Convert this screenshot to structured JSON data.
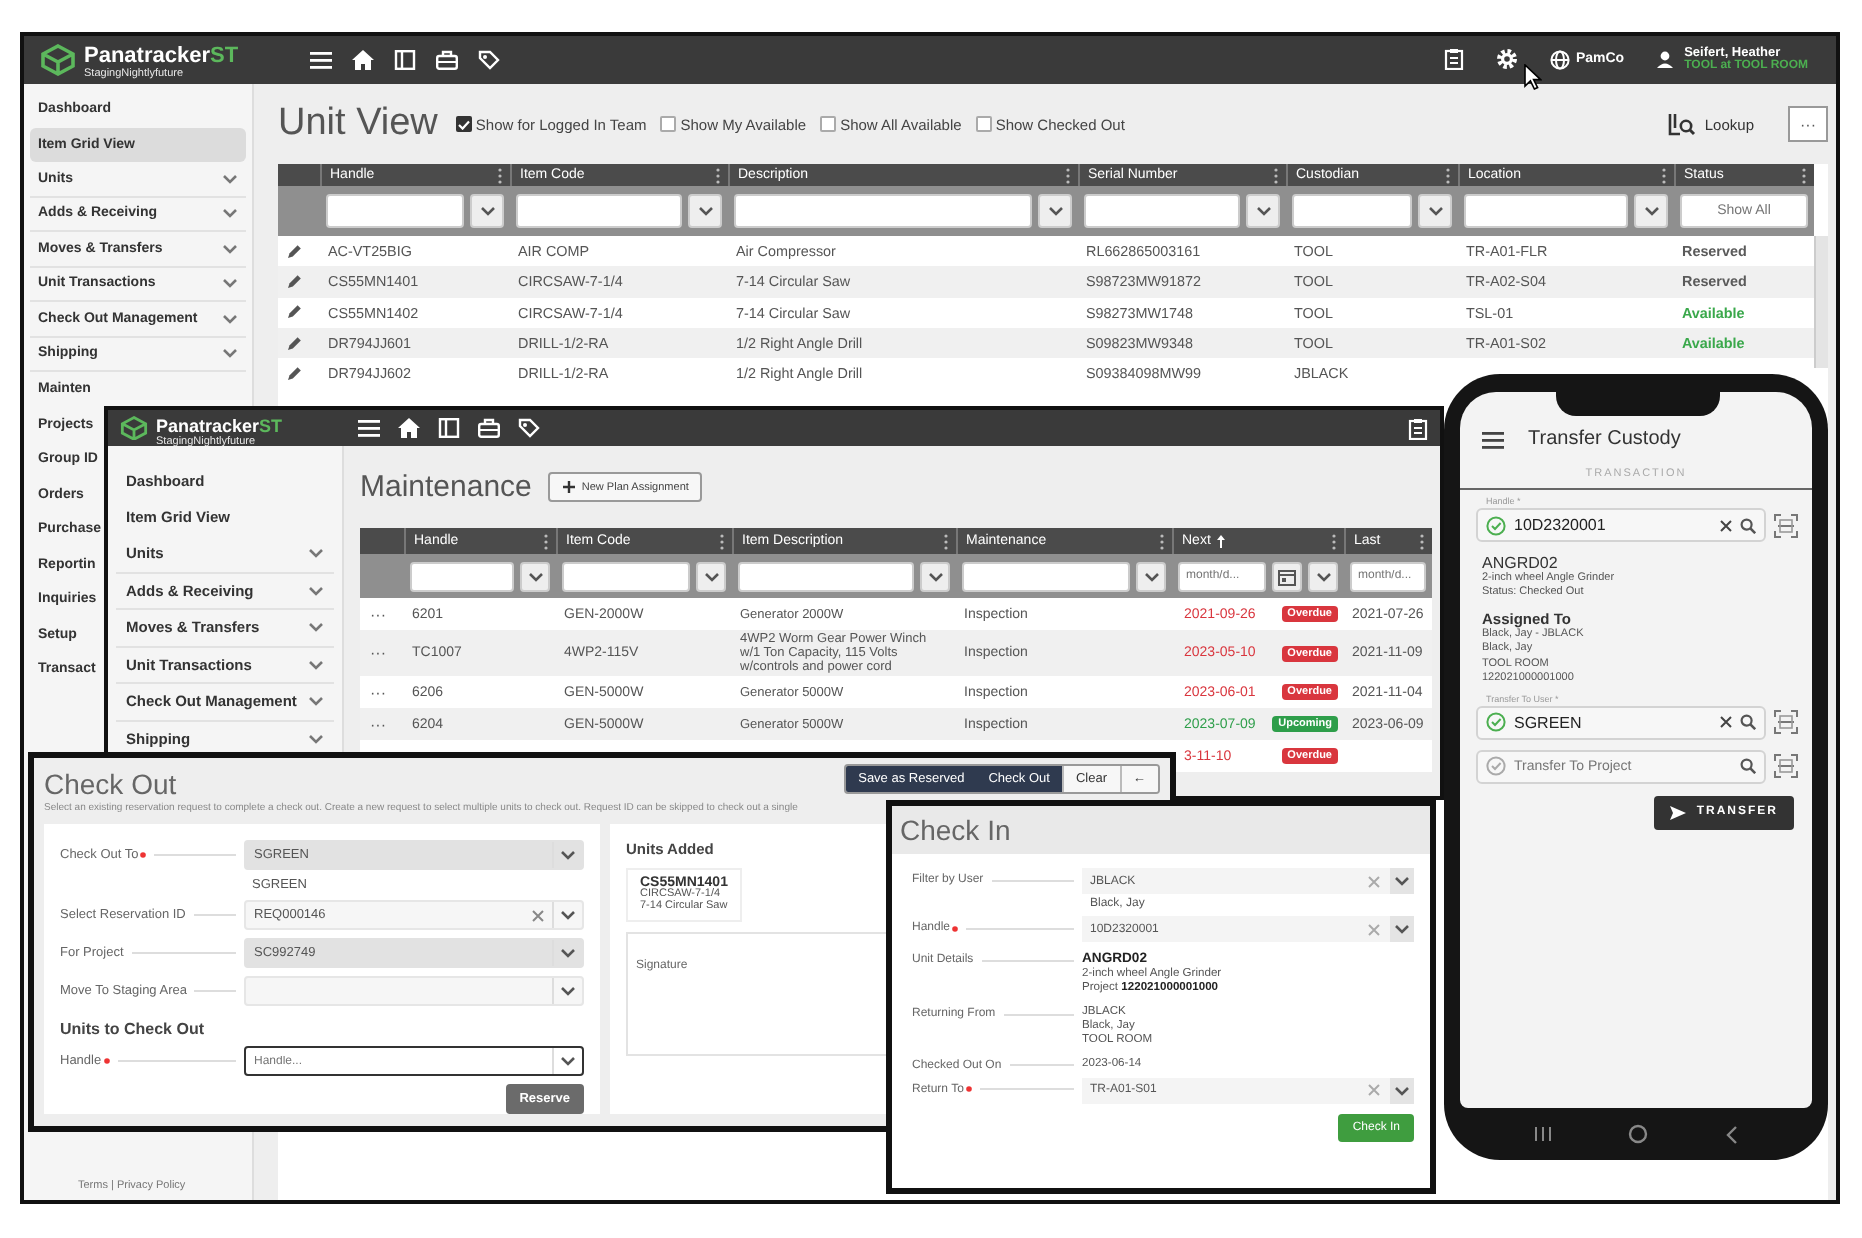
{
  "main": {
    "brand": "Panatracker",
    "brand_suffix": "ST",
    "env": "StagingNightlyfuture",
    "company": "PamCo",
    "user": "Seifert, Heather",
    "user_location": "TOOL at TOOL ROOM",
    "sidebar": [
      {
        "label": "Dashboard",
        "kind": "link",
        "selected": false
      },
      {
        "label": "Item Grid View",
        "kind": "link",
        "selected": true
      },
      {
        "label": "Units",
        "kind": "group",
        "selected": false
      },
      {
        "label": "Adds & Receiving",
        "kind": "group",
        "selected": false
      },
      {
        "label": "Moves & Transfers",
        "kind": "group",
        "selected": false
      },
      {
        "label": "Unit Transactions",
        "kind": "group",
        "selected": false
      },
      {
        "label": "Check Out Management",
        "kind": "group",
        "selected": false
      },
      {
        "label": "Shipping",
        "kind": "group",
        "selected": false
      },
      {
        "label": "Mainten",
        "kind": "link",
        "selected": false
      },
      {
        "label": "Projects",
        "kind": "link",
        "selected": false
      },
      {
        "label": "Group ID",
        "kind": "link",
        "selected": false
      },
      {
        "label": "Orders",
        "kind": "link",
        "selected": false
      },
      {
        "label": "Purchase",
        "kind": "link",
        "selected": false
      },
      {
        "label": "Reportin",
        "kind": "link",
        "selected": false
      },
      {
        "label": "Inquiries",
        "kind": "link",
        "selected": false
      },
      {
        "label": "Setup",
        "kind": "link",
        "selected": false
      },
      {
        "label": "Transact",
        "kind": "link",
        "selected": false
      }
    ],
    "footer": "Terms | Privacy Policy",
    "title": "Unit View",
    "filters": [
      {
        "label": "Show for Logged In Team",
        "checked": true
      },
      {
        "label": "Show My Available",
        "checked": false
      },
      {
        "label": "Show All Available",
        "checked": false
      },
      {
        "label": "Show Checked Out",
        "checked": false
      }
    ],
    "lookup": "Lookup",
    "more": "···",
    "columns": [
      "Handle",
      "Item Code",
      "Description",
      "Serial Number",
      "Custodian",
      "Location",
      "Status"
    ],
    "status_placeholder": "Show All",
    "rows": [
      {
        "cells": [
          "AC-VT25BIG",
          "AIR COMP",
          "Air Compressor",
          "RL662865003161",
          "TOOL",
          "TR-A01-FLR"
        ],
        "status": "Reserved",
        "color": "#5a5a5a"
      },
      {
        "cells": [
          "CS55MN1401",
          "CIRCSAW-7-1/4",
          "7-14 Circular Saw",
          "S98723MW91872",
          "TOOL",
          "TR-A02-S04"
        ],
        "status": "Reserved",
        "color": "#5a5a5a"
      },
      {
        "cells": [
          "CS55MN1402",
          "CIRCSAW-7-1/4",
          "7-14 Circular Saw",
          "S98273MW1748",
          "TOOL",
          "TSL-01"
        ],
        "status": "Available",
        "color": "#3aa84b"
      },
      {
        "cells": [
          "DR794JJ601",
          "DRILL-1/2-RA",
          "1/2 Right Angle Drill",
          "S09823MW9348",
          "TOOL",
          "TR-A01-S02"
        ],
        "status": "Available",
        "color": "#3aa84b"
      },
      {
        "cells": [
          "DR794JJ602",
          "DRILL-1/2-RA",
          "1/2 Right Angle Drill",
          "S09384098MW99",
          "JBLACK"
        ]
      }
    ]
  },
  "maintenance": {
    "brand": "Panatracker",
    "brand_suffix": "ST",
    "env": "StagingNightlyfuture",
    "sidebar": [
      {
        "label": "Dashboard",
        "kind": "link",
        "selected": false
      },
      {
        "label": "Item Grid View",
        "kind": "link",
        "selected": false
      },
      {
        "label": "Units",
        "kind": "group",
        "selected": false
      },
      {
        "label": "Adds & Receiving",
        "kind": "group",
        "selected": false
      },
      {
        "label": "Moves & Transfers",
        "kind": "group",
        "selected": false
      },
      {
        "label": "Unit Transactions",
        "kind": "group",
        "selected": false
      },
      {
        "label": "Check Out Management",
        "kind": "group",
        "selected": false
      },
      {
        "label": "Shipping",
        "kind": "group",
        "selected": false
      }
    ],
    "title": "Maintenance",
    "new_button": "New Plan Assignment",
    "columns": [
      {
        "label": "Handle",
        "kind": "text",
        "sorted": false
      },
      {
        "label": "Item Code",
        "kind": "text",
        "sorted": false
      },
      {
        "label": "Item Description",
        "kind": "text",
        "sorted": false
      },
      {
        "label": "Maintenance",
        "kind": "text",
        "sorted": false
      },
      {
        "label": "Next",
        "kind": "calendar",
        "sorted": true,
        "placeholder": "month/d..."
      },
      {
        "label": "Last",
        "kind": "date",
        "sorted": false,
        "placeholder": "month/d..."
      }
    ],
    "rows": [
      {
        "action": "···",
        "cells": [
          "6201",
          "GEN-2000W",
          "Generator 2000W",
          "Inspection"
        ],
        "next": "2021-09-26",
        "status": "Overdue",
        "color": "#d9363e",
        "last": "2021-07-26"
      },
      {
        "action": "···",
        "cells": [
          "TC1007",
          "4WP2-115V",
          "4WP2 Worm Gear Power Winch w/1 Ton Capacity, 115 Volts w/controls and power cord",
          "Inspection"
        ],
        "next": "2023-05-10",
        "status": "Overdue",
        "color": "#d9363e",
        "last": "2021-11-09"
      },
      {
        "action": "···",
        "cells": [
          "6206",
          "GEN-5000W",
          "Generator 5000W",
          "Inspection"
        ],
        "next": "2023-06-01",
        "status": "Overdue",
        "color": "#d9363e",
        "last": "2021-11-04"
      },
      {
        "action": "···",
        "cells": [
          "6204",
          "GEN-5000W",
          "Generator 5000W",
          "Inspection"
        ],
        "next": "2023-07-09",
        "status": "Upcoming",
        "color": "#2e9e4a",
        "last": "2023-06-09"
      },
      {
        "next": "3-11-10",
        "status": "Overdue",
        "color": "#d9363e"
      }
    ]
  },
  "checkout": {
    "title": "Check Out",
    "actions": [
      {
        "label": "Save as Reserved",
        "kind": "primary"
      },
      {
        "label": "Check Out",
        "kind": "primary"
      },
      {
        "label": "Clear",
        "kind": "plain"
      },
      {
        "label": "←",
        "kind": "plain"
      }
    ],
    "hint": "Select an existing reservation request to complete a check out. Create a new request to select multiple units to check out. Request ID can be skipped to check out a single",
    "fields": [
      {
        "label": "Check Out To",
        "required": true,
        "value": "SGREEN",
        "note": "SGREEN",
        "disabled": true,
        "clearable": false
      },
      {
        "label": "Select Reservation ID",
        "required": false,
        "value": "REQ000146",
        "disabled": false,
        "clearable": true
      },
      {
        "label": "For Project",
        "required": false,
        "value": "SC992749",
        "disabled": true,
        "clearable": false
      },
      {
        "label": "Move To Staging Area",
        "required": false,
        "disabled": false,
        "clearable": false
      }
    ],
    "units_heading": "Units to Check Out",
    "handle": {
      "label": "Handle",
      "required": true,
      "placeholder": "Handle..."
    },
    "reserve": "Reserve",
    "units_added": "Units Added",
    "added": [
      {
        "handle": "CS55MN1401",
        "code": "CIRCSAW-7-1/4",
        "description": "7-14 Circular Saw"
      }
    ],
    "signature": "Signature"
  },
  "checkin": {
    "title": "Check In",
    "fields": [
      {
        "label": "Filter by User",
        "kind": "select",
        "required": false,
        "value": "JBLACK",
        "note": "Black, Jay"
      },
      {
        "label": "Handle",
        "kind": "select",
        "required": true,
        "value": "10D2320001"
      },
      {
        "label": "Unit Details",
        "kind": "details",
        "required": false,
        "heading": "ANGRD02",
        "lines": [
          "2-inch wheel Angle Grinder",
          "Project **122021000001000**"
        ]
      },
      {
        "label": "Returning From",
        "kind": "text",
        "required": false,
        "lines": [
          "JBLACK",
          "Black, Jay",
          "TOOL ROOM"
        ]
      },
      {
        "label": "Checked Out On",
        "kind": "text",
        "required": false,
        "lines": [
          "2023-06-14"
        ]
      },
      {
        "label": "Return To",
        "kind": "select",
        "required": true,
        "value": "TR-A01-S01"
      }
    ],
    "button": "Check In"
  },
  "phone": {
    "title": "Transfer Custody",
    "tab": "TRANSACTION",
    "fields": [
      {
        "label": "Handle *",
        "value": "10D2320001"
      },
      {
        "label": "Transfer To User *",
        "value": "SGREEN"
      },
      {
        "placeholder": "Transfer To Project"
      }
    ],
    "unit": {
      "code": "ANGRD02",
      "lines": [
        "2-inch wheel Angle Grinder",
        "Status: Checked Out"
      ]
    },
    "assigned": {
      "heading": "Assigned To",
      "lines": [
        "Black, Jay - JBLACK",
        "Black, Jay",
        "TOOL ROOM",
        "122021000001000"
      ]
    },
    "button": "TRANSFER"
  }
}
